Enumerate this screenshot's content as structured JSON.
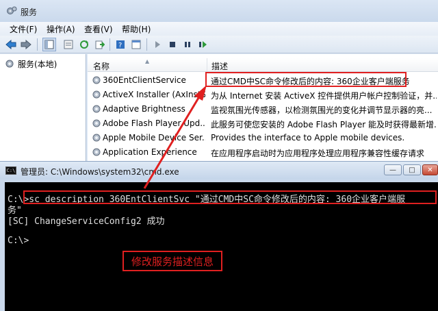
{
  "services_window": {
    "title": "服务",
    "menu": [
      "文件(F)",
      "操作(A)",
      "查看(V)",
      "帮助(H)"
    ],
    "tree_root": "服务(本地)",
    "columns": {
      "name": "名称",
      "description": "描述"
    },
    "rows": [
      {
        "name": "360EntClientService",
        "description": "通过CMD中SC命令修改后的内容: 360企业客户端服务"
      },
      {
        "name": "ActiveX Installer (AxInstS...",
        "description": "为从 Internet 安装 ActiveX 控件提供用户帐户控制验证，并..."
      },
      {
        "name": "Adaptive Brightness",
        "description": "监视氛围光传感器，以检测氛围光的变化并调节显示器的亮..."
      },
      {
        "name": "Adobe Flash Player Upd...",
        "description": "此服务可使您安装的 Adobe Flash Player 能及时获得最新增..."
      },
      {
        "name": "Apple Mobile Device Ser...",
        "description": "Provides the interface to Apple mobile devices."
      },
      {
        "name": "Application Experience",
        "description": "在应用程序启动时为应用程序处理应用程序兼容性缓存请求"
      }
    ]
  },
  "cmd_window": {
    "title": "管理员: C:\\Windows\\system32\\cmd.exe",
    "icon_text": "C:\\",
    "buttons": {
      "minimize": "—",
      "maximize": "□",
      "close": "✕"
    },
    "lines": [
      "C:\\>sc description 360EntClientSvc \"通过CMD中SC命令修改后的内容: 360企业客户端服",
      "务\"",
      "[SC] ChangeServiceConfig2 成功",
      "",
      "C:\\>"
    ],
    "annotation": "修改服务描述信息"
  },
  "colors": {
    "highlight": "#e02020",
    "console_bg": "#000000"
  }
}
